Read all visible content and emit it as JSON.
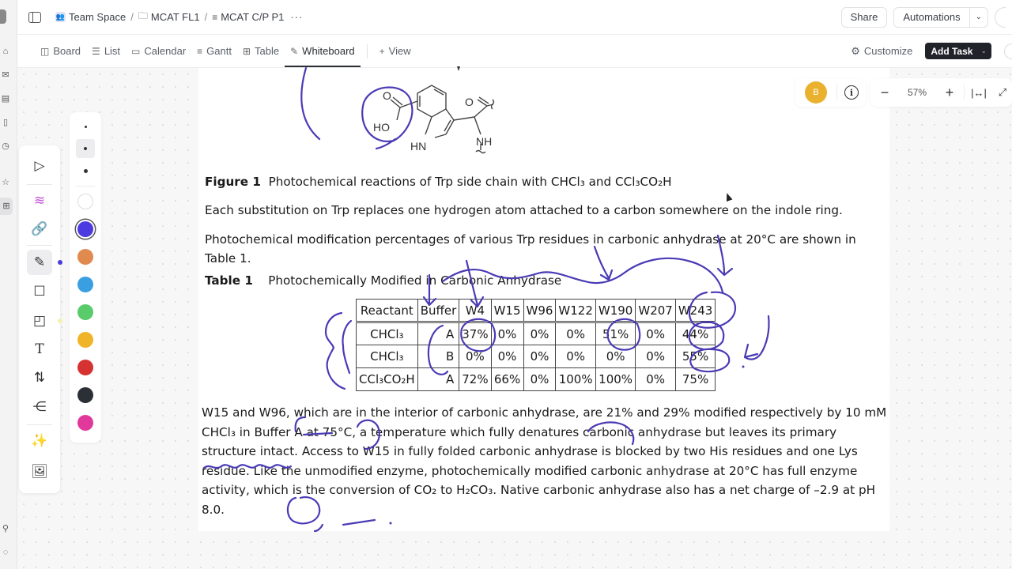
{
  "breadcrumb": {
    "items": [
      {
        "label": "Team Space",
        "icon": "team-icon"
      },
      {
        "label": "MCAT FL1",
        "icon": "folder-icon"
      },
      {
        "label": "MCAT C/P P1",
        "icon": "list-icon"
      }
    ],
    "more_label": "···"
  },
  "header": {
    "share_label": "Share",
    "automations_label": "Automations"
  },
  "views": {
    "tabs": [
      {
        "label": "Board",
        "icon": "board-icon"
      },
      {
        "label": "List",
        "icon": "list-icon"
      },
      {
        "label": "Calendar",
        "icon": "calendar-icon"
      },
      {
        "label": "Gantt",
        "icon": "gantt-icon"
      },
      {
        "label": "Table",
        "icon": "table-icon"
      },
      {
        "label": "Whiteboard",
        "icon": "whiteboard-icon",
        "active": true
      }
    ],
    "add_view_label": "View",
    "customize_label": "Customize",
    "add_task_label": "Add Task"
  },
  "zoom_controls": {
    "avatar_initial": "B",
    "zoom_level": "57%"
  },
  "palette": {
    "colors": [
      "#ffffff",
      "#4b3be0",
      "#e08a4f",
      "#3a9fe0",
      "#5acb6a",
      "#f0b429",
      "#d63232",
      "#2b2f36",
      "#e0399b"
    ],
    "selected_color": "#4b3be0"
  },
  "document": {
    "figure_label": "Figure 1",
    "figure_caption": "Photochemical reactions of Trp side chain with CHCl₃ and CCl₃CO₂H",
    "paragraph_1": "Each substitution on Trp replaces one hydrogen atom attached to a carbon somewhere on the indole ring.",
    "paragraph_2": "Photochemical modification percentages of various Trp residues in carbonic anhydrase at 20°C are shown in Table 1.",
    "table_label": "Table 1",
    "table_caption": "Photochemically Modified in Carbonic Anhydrase",
    "paragraph_3": "W15 and W96, which are in the interior of carbonic anhydrase, are 21% and 29% modified respectively by 10 mM CHCl₃ in Buffer A at 75°C, a temperature which fully denatures carbonic anhydrase but leaves its primary structure intact. Access to W15 in fully folded carbonic anhydrase is blocked by two His residues and one Lys residue. Like the unmodified enzyme, photochemically modified carbonic anhydrase at 20°C has full enzyme activity, which is the conversion of CO₂ to H₂CO₃. Native carbonic anhydrase also has a net charge of –2.9 at pH 8.0."
  },
  "molecule": {
    "labels": [
      "O",
      "HO",
      "O",
      "HN",
      "NH"
    ]
  },
  "table": {
    "headers": [
      "Reactant",
      "Buffer",
      "W4",
      "W15",
      "W96",
      "W122",
      "W190",
      "W207",
      "W243"
    ],
    "rows": [
      [
        "CHCl₃",
        "A",
        "37%",
        "0%",
        "0%",
        "0%",
        "51%",
        "0%",
        "44%"
      ],
      [
        "CHCl₃",
        "B",
        "0%",
        "0%",
        "0%",
        "0%",
        "0%",
        "0%",
        "55%"
      ],
      [
        "CCl₃CO₂H",
        "A",
        "72%",
        "66%",
        "0%",
        "100%",
        "100%",
        "0%",
        "75%"
      ]
    ]
  }
}
